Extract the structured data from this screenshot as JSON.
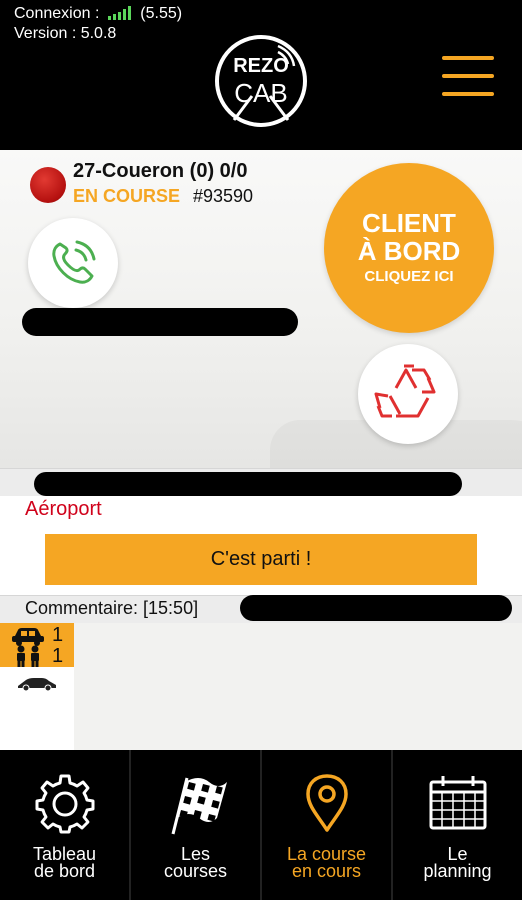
{
  "header": {
    "connection_label": "Connexion :",
    "connection_value": "(5.55)",
    "version_label": "Version : 5.0.8",
    "logo_top": "REZO",
    "logo_bottom": "CAB",
    "menu_icon": "hamburger-menu-icon"
  },
  "course": {
    "id_line": "27-Coueron (0) 0/0",
    "status": "EN COURSE",
    "number": "#93590",
    "status_color": "#f5a623",
    "dot_color": "#c91a16"
  },
  "actions": {
    "phone_icon": "phone-ringing-icon",
    "client_line1": "CLIENT",
    "client_line2": "À BORD",
    "client_line3": "CLIQUEZ ICI",
    "recycle_icon": "recycle-icon"
  },
  "trip": {
    "destination": "Aéroport",
    "go_button": "C'est parti !",
    "comment_label": "Commentaire: [15:50]"
  },
  "counts": {
    "vehicles": "1",
    "passengers": "1",
    "car_icon": "car-icon",
    "people_icon": "people-icon",
    "vehicle_type_icon": "sedan-icon"
  },
  "nav": {
    "items": [
      {
        "line1": "Tableau",
        "line2": "de bord",
        "icon": "gear-icon"
      },
      {
        "line1": "Les",
        "line2": "courses",
        "icon": "checkered-flag-icon"
      },
      {
        "line1": "La course",
        "line2": "en cours",
        "icon": "map-pin-icon"
      },
      {
        "line1": "Le",
        "line2": "planning",
        "icon": "calendar-icon"
      }
    ],
    "active_index": 2
  },
  "colors": {
    "accent": "#f5a623",
    "destination": "#d0021b",
    "background": "#000000"
  }
}
